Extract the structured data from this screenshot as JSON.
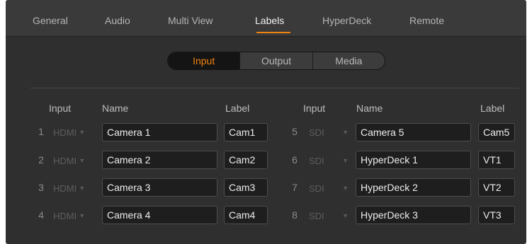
{
  "tabs": [
    {
      "label": "General"
    },
    {
      "label": "Audio"
    },
    {
      "label": "Multi View"
    },
    {
      "label": "Labels"
    },
    {
      "label": "HyperDeck"
    },
    {
      "label": "Remote"
    }
  ],
  "active_tab": "Labels",
  "segments": [
    {
      "label": "Input"
    },
    {
      "label": "Output"
    },
    {
      "label": "Media"
    }
  ],
  "active_segment": "Input",
  "columns": {
    "left": {
      "input": "Input",
      "name": "Name",
      "label": "Label"
    },
    "right": {
      "input": "Input",
      "name": "Name",
      "label": "Label"
    }
  },
  "left_rows": [
    {
      "number": "1",
      "input": "HDMI",
      "name": "Camera 1",
      "label": "Cam1"
    },
    {
      "number": "2",
      "input": "HDMI",
      "name": "Camera 2",
      "label": "Cam2"
    },
    {
      "number": "3",
      "input": "HDMI",
      "name": "Camera 3",
      "label": "Cam3"
    },
    {
      "number": "4",
      "input": "HDMI",
      "name": "Camera 4",
      "label": "Cam4"
    }
  ],
  "right_rows": [
    {
      "number": "5",
      "input": "SDI",
      "name": "Camera 5",
      "label": "Cam5"
    },
    {
      "number": "6",
      "input": "SDI",
      "name": "HyperDeck 1",
      "label": "VT1"
    },
    {
      "number": "7",
      "input": "SDI",
      "name": "HyperDeck 2",
      "label": "VT2"
    },
    {
      "number": "8",
      "input": "SDI",
      "name": "HyperDeck 3",
      "label": "VT3"
    }
  ],
  "colors": {
    "accent": "#f0820f",
    "panel": "#2f2f2f",
    "field": "#1e1e1e"
  },
  "icons": {
    "dropdown": "caret-down-icon"
  }
}
